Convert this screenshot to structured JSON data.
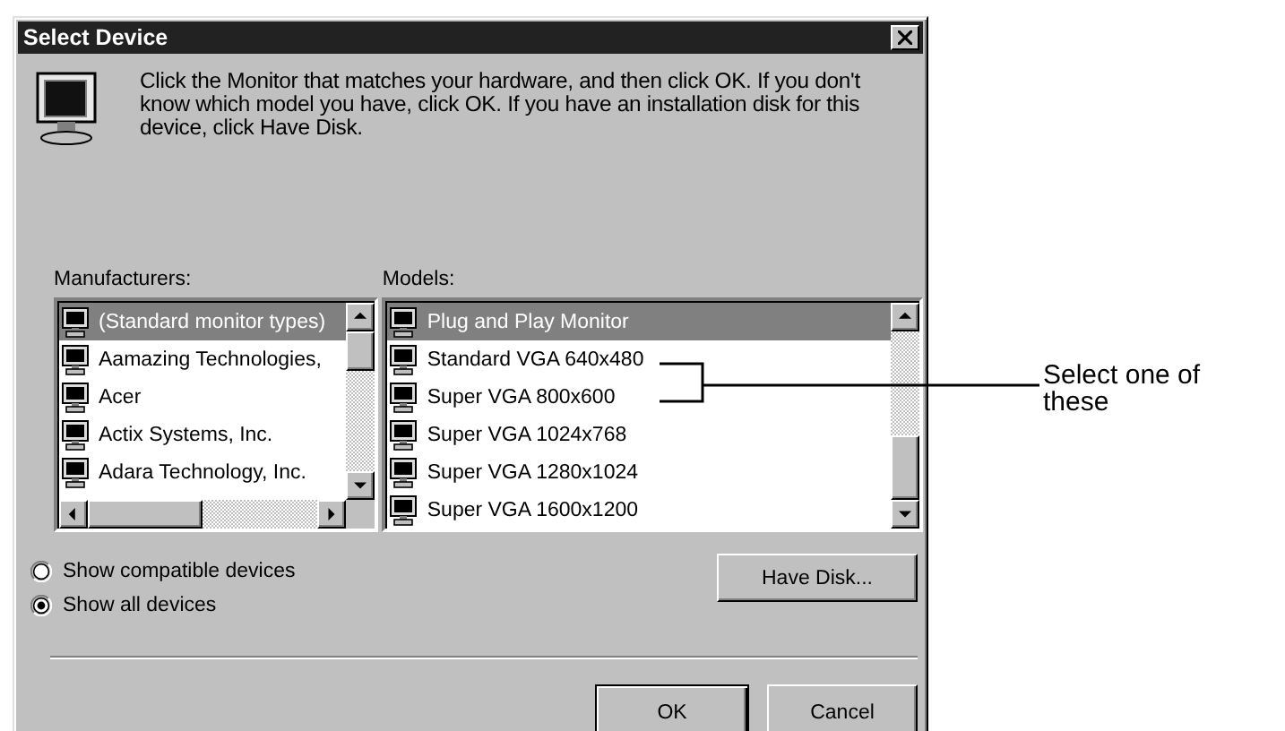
{
  "window": {
    "title": "Select Device"
  },
  "message": "Click the Monitor that matches your hardware, and then click OK. If you don't know which model you have, click OK. If you have an installation disk for this device, click Have Disk.",
  "manufacturers": {
    "label": "Manufacturers:",
    "items": [
      {
        "label": "(Standard monitor types)",
        "selected": true
      },
      {
        "label": "Aamazing Technologies,",
        "selected": false
      },
      {
        "label": "Acer",
        "selected": false
      },
      {
        "label": "Actix Systems, Inc.",
        "selected": false
      },
      {
        "label": "Adara Technology, Inc.",
        "selected": false
      }
    ]
  },
  "models": {
    "label": "Models:",
    "items": [
      {
        "label": "Plug and Play Monitor",
        "selected": true
      },
      {
        "label": "Standard VGA 640x480",
        "selected": false
      },
      {
        "label": "Super VGA  800x600",
        "selected": false
      },
      {
        "label": "Super VGA 1024x768",
        "selected": false
      },
      {
        "label": "Super VGA 1280x1024",
        "selected": false
      },
      {
        "label": "Super VGA 1600x1200",
        "selected": false
      }
    ]
  },
  "options": [
    {
      "label": "Show compatible devices",
      "selected": false
    },
    {
      "label": "Show all devices",
      "selected": true
    }
  ],
  "buttons": [
    {
      "label": "Have Disk...",
      "kind": "side"
    },
    {
      "label": "OK",
      "kind": "default"
    },
    {
      "label": "Cancel",
      "kind": "normal"
    }
  ],
  "callout": {
    "text": "Select one of these"
  }
}
